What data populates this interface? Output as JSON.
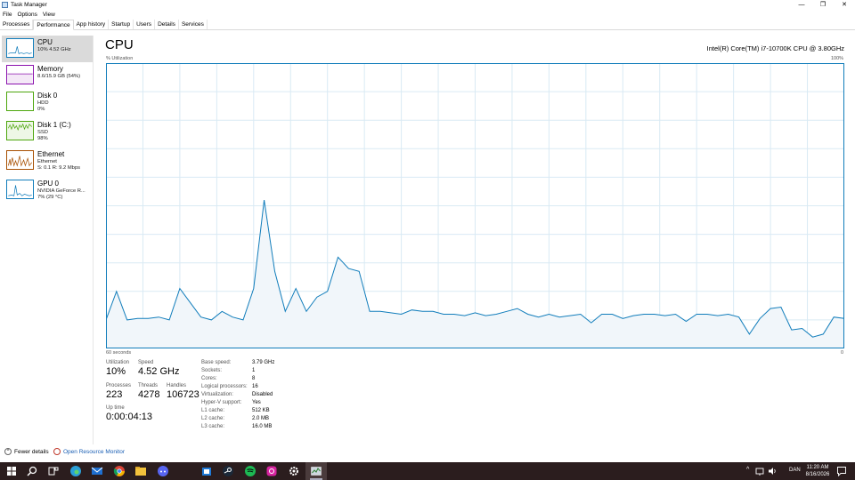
{
  "window": {
    "title": "Task Manager",
    "min_glyph": "—",
    "max_glyph": "❐",
    "close_glyph": "✕"
  },
  "menu": [
    "File",
    "Options",
    "View"
  ],
  "tabs": [
    "Processes",
    "Performance",
    "App history",
    "Startup",
    "Users",
    "Details",
    "Services"
  ],
  "active_tab": "Performance",
  "sidebar": [
    {
      "title": "CPU",
      "lines": [
        "10% 4.52 GHz"
      ],
      "color": "#117dbb"
    },
    {
      "title": "Memory",
      "lines": [
        "8.6/15.9 GB (54%)"
      ],
      "color": "#8b12ae"
    },
    {
      "title": "Disk 0",
      "lines": [
        "HDD",
        "0%"
      ],
      "color": "#4da60c"
    },
    {
      "title": "Disk 1 (C:)",
      "lines": [
        "SSD",
        "98%"
      ],
      "color": "#4da60c"
    },
    {
      "title": "Ethernet",
      "lines": [
        "Ethernet",
        "S: 0.1 R: 9.2 Mbps"
      ],
      "color": "#a74f01"
    },
    {
      "title": "GPU 0",
      "lines": [
        "NVIDIA GeForce R...",
        "7% (29 °C)"
      ],
      "color": "#117dbb"
    }
  ],
  "main": {
    "title": "CPU",
    "cpu_name": "Intel(R) Core(TM) i7-10700K CPU @ 3.80GHz",
    "util_label": "% Utilization",
    "util_max": "100%",
    "time_label": "60 seconds",
    "zero_label": "0",
    "graph_color": "#117dbb",
    "graph_fill": "#f1f6fa",
    "grid_color": "#d9eaf4"
  },
  "chart_data": {
    "type": "area",
    "ylabel": "% Utilization",
    "ylim": [
      0,
      100
    ],
    "xlim": [
      60,
      0
    ],
    "values": [
      10,
      20,
      10,
      10.5,
      10.5,
      11,
      10,
      21,
      16,
      11,
      10,
      13,
      11,
      10,
      21,
      52,
      27,
      13,
      21,
      13,
      18,
      20,
      32,
      28,
      27,
      13,
      13,
      12.5,
      12,
      13.5,
      13,
      13,
      12,
      12,
      11.5,
      12.5,
      11.5,
      12,
      13,
      14,
      12,
      11,
      12,
      11,
      11.5,
      12,
      9,
      12,
      12,
      10.5,
      11.5,
      12,
      12,
      11.5,
      12,
      9.5,
      12,
      12,
      11.5,
      12,
      11,
      5,
      10.5,
      14,
      14.5,
      6.5,
      7,
      4,
      5,
      11,
      10.5
    ]
  },
  "stats": {
    "utilization_label": "Utilization",
    "utilization": "10%",
    "speed_label": "Speed",
    "speed": "4.52 GHz",
    "processes_label": "Processes",
    "processes": "223",
    "threads_label": "Threads",
    "threads": "4278",
    "handles_label": "Handles",
    "handles": "106723",
    "uptime_label": "Up time",
    "uptime": "0:00:04:13"
  },
  "specs": [
    {
      "k": "Base speed:",
      "v": "3.79 GHz"
    },
    {
      "k": "Sockets:",
      "v": "1"
    },
    {
      "k": "Cores:",
      "v": "8"
    },
    {
      "k": "Logical processors:",
      "v": "16"
    },
    {
      "k": "Virtualization:",
      "v": "Disabled"
    },
    {
      "k": "Hyper-V support:",
      "v": "Yes"
    },
    {
      "k": "L1 cache:",
      "v": "512 KB"
    },
    {
      "k": "L2 cache:",
      "v": "2.0 MB"
    },
    {
      "k": "L3 cache:",
      "v": "16.0 MB"
    }
  ],
  "footer": {
    "fewer_details": "Fewer details",
    "open_resource_monitor": "Open Resource Monitor"
  },
  "taskbar": {
    "icons": [
      "windows-start",
      "search",
      "task-view",
      "edge",
      "mail",
      "chrome",
      "file-explorer",
      "discord",
      "store",
      "steam",
      "spotify",
      "instagram",
      "settings",
      "task-manager"
    ],
    "language": "DAN",
    "time": "11:20 AM",
    "date": "8/16/2026"
  }
}
